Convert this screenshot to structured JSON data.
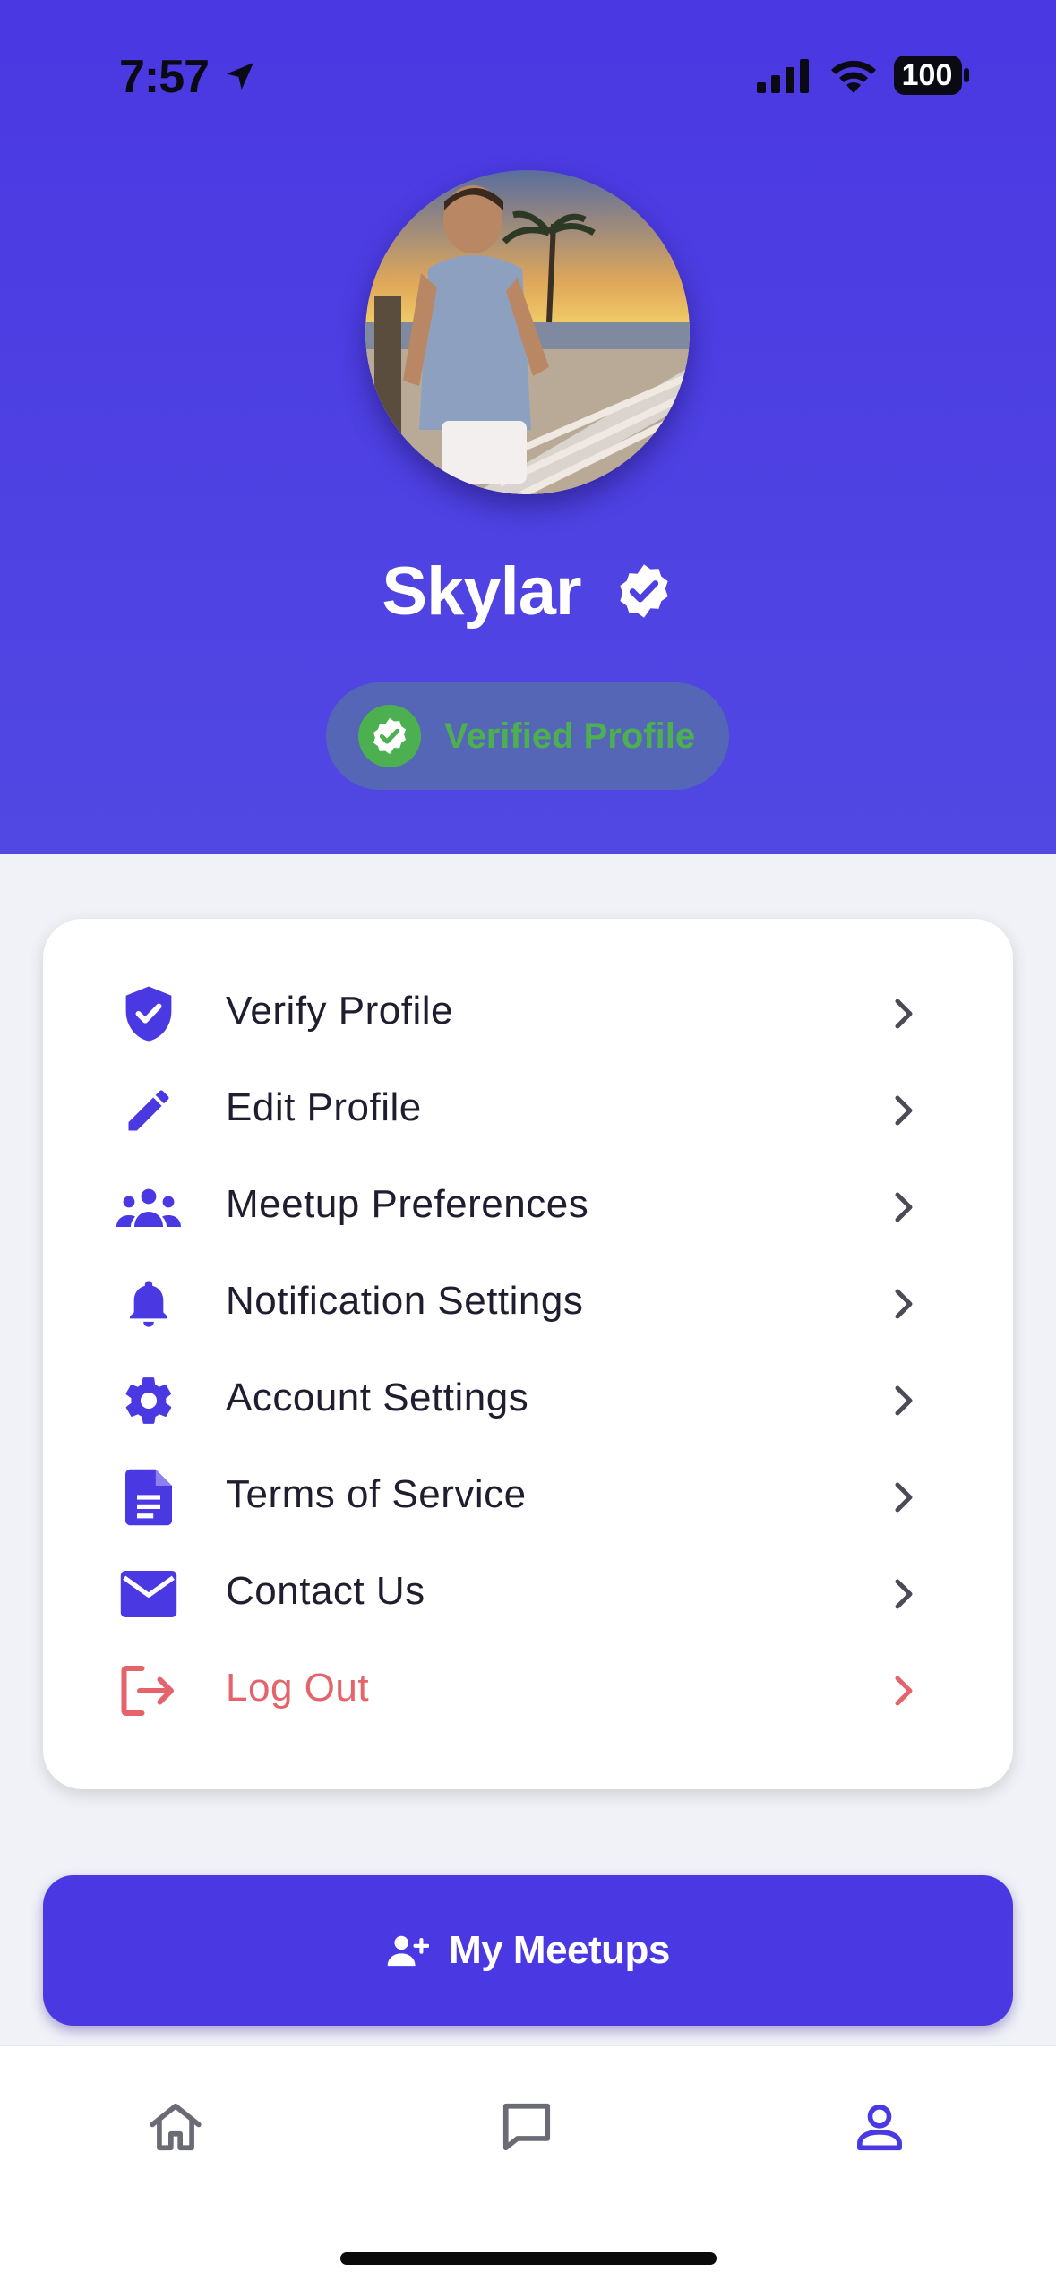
{
  "status_bar": {
    "time": "7:57",
    "battery": "100"
  },
  "profile": {
    "name": "Skylar",
    "verified_badge": "Verified Profile"
  },
  "menu": {
    "items": [
      {
        "label": "Verify Profile",
        "icon": "shield-check-icon"
      },
      {
        "label": "Edit Profile",
        "icon": "pencil-icon"
      },
      {
        "label": "Meetup Preferences",
        "icon": "group-icon"
      },
      {
        "label": "Notification Settings",
        "icon": "bell-icon"
      },
      {
        "label": "Account Settings",
        "icon": "gear-icon"
      },
      {
        "label": "Terms of Service",
        "icon": "document-icon"
      },
      {
        "label": "Contact Us",
        "icon": "envelope-icon"
      },
      {
        "label": "Log Out",
        "icon": "logout-icon"
      }
    ]
  },
  "primary_action": {
    "label": "My Meetups",
    "icon": "user-plus-icon"
  },
  "tab_bar": {
    "tabs": [
      {
        "name": "home",
        "icon": "home-icon"
      },
      {
        "name": "messages",
        "icon": "chat-bubble-icon"
      },
      {
        "name": "profile",
        "icon": "person-icon",
        "active": true
      }
    ]
  },
  "colors": {
    "accent": "#4a38e2",
    "danger": "#e5636a",
    "verified": "#4caf50",
    "background": "#f0f2f7"
  }
}
